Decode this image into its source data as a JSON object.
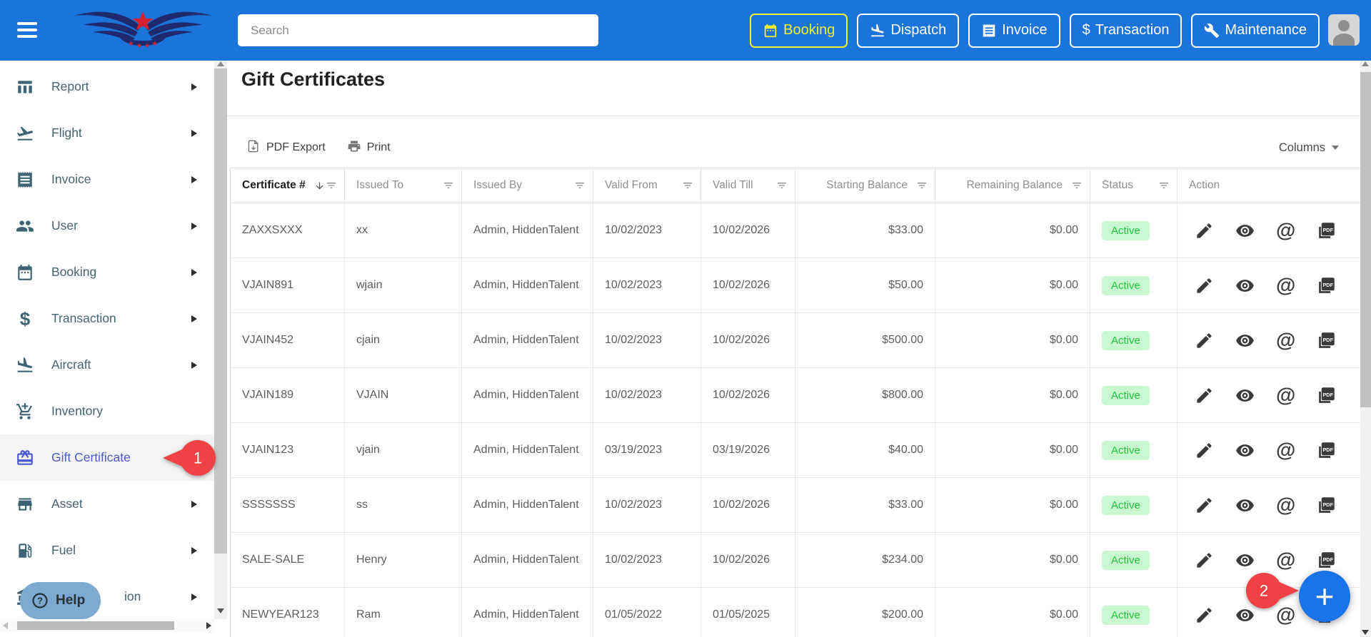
{
  "header": {
    "search": {
      "placeholder": "Search"
    },
    "nav_buttons": [
      {
        "label": "Booking",
        "icon": "calendar-icon",
        "active": true
      },
      {
        "label": "Dispatch",
        "icon": "plane-landing-icon",
        "active": false
      },
      {
        "label": "Invoice",
        "icon": "receipt-icon",
        "active": false
      },
      {
        "label": "Transaction",
        "icon": "dollar-icon",
        "active": false
      },
      {
        "label": "Maintenance",
        "icon": "wrench-icon",
        "active": false
      }
    ]
  },
  "sidebar": {
    "items": [
      {
        "label": "Report",
        "icon": "bar-chart-icon",
        "expandable": true,
        "selected": false
      },
      {
        "label": "Flight",
        "icon": "plane-takeoff-icon",
        "expandable": true,
        "selected": false
      },
      {
        "label": "Invoice",
        "icon": "receipt-icon",
        "expandable": true,
        "selected": false
      },
      {
        "label": "User",
        "icon": "people-icon",
        "expandable": true,
        "selected": false
      },
      {
        "label": "Booking",
        "icon": "calendar-icon",
        "expandable": true,
        "selected": false
      },
      {
        "label": "Transaction",
        "icon": "dollar-icon",
        "expandable": true,
        "selected": false
      },
      {
        "label": "Aircraft",
        "icon": "plane-landing-icon",
        "expandable": true,
        "selected": false
      },
      {
        "label": "Inventory",
        "icon": "cart-plus-icon",
        "expandable": false,
        "selected": false
      },
      {
        "label": "Gift Certificate",
        "icon": "gift-icon",
        "expandable": false,
        "selected": true
      },
      {
        "label": "Asset",
        "icon": "store-icon",
        "expandable": true,
        "selected": false
      },
      {
        "label": "Fuel",
        "icon": "fuel-pump-icon",
        "expandable": true,
        "selected": false
      },
      {
        "label": "ion",
        "icon": "building-icon",
        "expandable": true,
        "selected": false,
        "occluded_by_help": true
      }
    ],
    "help_label": "Help"
  },
  "page": {
    "title": "Gift Certificates",
    "toolbar": {
      "pdf_export_label": "PDF Export",
      "print_label": "Print",
      "columns_label": "Columns"
    }
  },
  "table": {
    "columns": [
      {
        "label": "Certificate #",
        "sorted": "desc",
        "filter": true
      },
      {
        "label": "Issued To",
        "filter": true
      },
      {
        "label": "Issued By",
        "filter": true
      },
      {
        "label": "Valid From",
        "filter": true
      },
      {
        "label": "Valid Till",
        "filter": true
      },
      {
        "label": "Starting Balance",
        "filter": true,
        "align": "right"
      },
      {
        "label": "Remaining Balance",
        "filter": true,
        "align": "right"
      },
      {
        "label": "Status",
        "filter": true
      },
      {
        "label": "Action",
        "filter": false
      }
    ],
    "rows": [
      {
        "certificate": "ZAXXSXXX",
        "issued_to": "xx",
        "issued_by": "Admin, HiddenTalent",
        "valid_from": "10/02/2023",
        "valid_till": "10/02/2026",
        "starting_balance": "$33.00",
        "remaining_balance": "$0.00",
        "status": "Active"
      },
      {
        "certificate": "VJAIN891",
        "issued_to": "wjain",
        "issued_by": "Admin, HiddenTalent",
        "valid_from": "10/02/2023",
        "valid_till": "10/02/2026",
        "starting_balance": "$50.00",
        "remaining_balance": "$0.00",
        "status": "Active"
      },
      {
        "certificate": "VJAIN452",
        "issued_to": "cjain",
        "issued_by": "Admin, HiddenTalent",
        "valid_from": "10/02/2023",
        "valid_till": "10/02/2026",
        "starting_balance": "$500.00",
        "remaining_balance": "$0.00",
        "status": "Active"
      },
      {
        "certificate": "VJAIN189",
        "issued_to": "VJAIN",
        "issued_by": "Admin, HiddenTalent",
        "valid_from": "10/02/2023",
        "valid_till": "10/02/2026",
        "starting_balance": "$800.00",
        "remaining_balance": "$0.00",
        "status": "Active"
      },
      {
        "certificate": "VJAIN123",
        "issued_to": "vjain",
        "issued_by": "Admin, HiddenTalent",
        "valid_from": "03/19/2023",
        "valid_till": "03/19/2026",
        "starting_balance": "$40.00",
        "remaining_balance": "$0.00",
        "status": "Active"
      },
      {
        "certificate": "SSSSSSS",
        "issued_to": "ss",
        "issued_by": "Admin, HiddenTalent",
        "valid_from": "10/02/2023",
        "valid_till": "10/02/2026",
        "starting_balance": "$33.00",
        "remaining_balance": "$0.00",
        "status": "Active"
      },
      {
        "certificate": "SALE-SALE",
        "issued_to": "Henry",
        "issued_by": "Admin, HiddenTalent",
        "valid_from": "10/02/2023",
        "valid_till": "10/02/2026",
        "starting_balance": "$234.00",
        "remaining_balance": "$0.00",
        "status": "Active"
      },
      {
        "certificate": "NEWYEAR123",
        "issued_to": "Ram",
        "issued_by": "Admin, HiddenTalent",
        "valid_from": "01/05/2022",
        "valid_till": "01/05/2025",
        "starting_balance": "$200.00",
        "remaining_balance": "$0.00",
        "status": "Active"
      }
    ],
    "row_actions": [
      "edit",
      "view",
      "email",
      "pdf"
    ]
  },
  "annotations": {
    "step1": "1",
    "step2": "2"
  },
  "fab": {
    "label": "+"
  },
  "colors": {
    "topbar_blue": "#1b74d9",
    "active_nav_yellow": "#f4ee35",
    "sidebar_icon_teal": "#3e6374",
    "selected_item_indigo": "#4a59cf",
    "status_active_bg": "#c9f8d0",
    "status_active_text": "#1ec53c",
    "annotation_red": "#ee4245",
    "fab_blue": "#1a73e8"
  }
}
